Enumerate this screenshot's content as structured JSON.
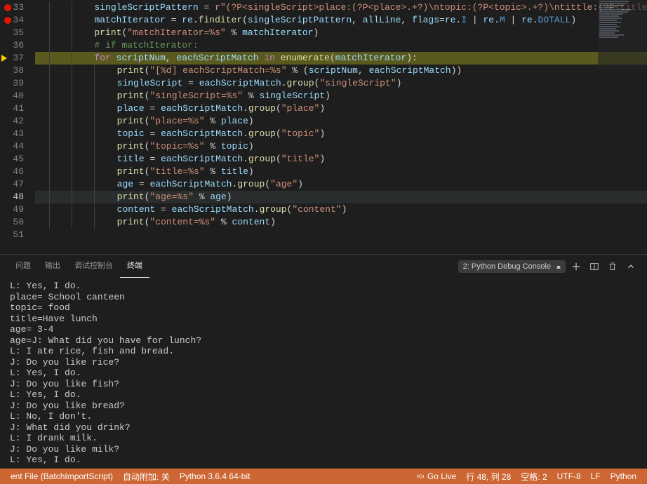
{
  "gutter": {
    "start": 33,
    "end": 51,
    "breakpoints": [
      33,
      34
    ],
    "current_arrow": 37,
    "active_line": 48
  },
  "code": {
    "33": {
      "indent": 2,
      "tokens": [
        [
          "var",
          "singleScriptPattern"
        ],
        [
          "op",
          " = "
        ],
        [
          "kw",
          "r"
        ],
        [
          "str",
          "\"(?P<singleScript>place:(?P<place>.+?)\\ntopic:(?P<topic>.+?)\\ntittle:(?P<title>.+?)"
        ]
      ]
    },
    "34": {
      "indent": 2,
      "tokens": [
        [
          "var",
          "matchIterator"
        ],
        [
          "op",
          " = "
        ],
        [
          "var",
          "re"
        ],
        [
          "op",
          "."
        ],
        [
          "fn",
          "finditer"
        ],
        [
          "op",
          "("
        ],
        [
          "var",
          "singleScriptPattern"
        ],
        [
          "op",
          ", "
        ],
        [
          "var",
          "allLine"
        ],
        [
          "op",
          ", "
        ],
        [
          "var",
          "flags"
        ],
        [
          "op",
          "="
        ],
        [
          "var",
          "re"
        ],
        [
          "op",
          "."
        ],
        [
          "const",
          "I"
        ],
        [
          "op",
          " | "
        ],
        [
          "var",
          "re"
        ],
        [
          "op",
          "."
        ],
        [
          "const",
          "M"
        ],
        [
          "op",
          " | "
        ],
        [
          "var",
          "re"
        ],
        [
          "op",
          "."
        ],
        [
          "const",
          "DOTALL"
        ],
        [
          "op",
          ")"
        ]
      ]
    },
    "35": {
      "indent": 2,
      "tokens": [
        [
          "fn",
          "print"
        ],
        [
          "op",
          "("
        ],
        [
          "str",
          "\"matchIterator=%s\""
        ],
        [
          "op",
          " % "
        ],
        [
          "var",
          "matchIterator"
        ],
        [
          "op",
          ")"
        ]
      ]
    },
    "36": {
      "indent": 2,
      "tokens": [
        [
          "cmt",
          "# if matchIterator:"
        ]
      ]
    },
    "37": {
      "indent": 2,
      "hl": "step",
      "tokens": [
        [
          "kw",
          "for"
        ],
        [
          "op",
          " "
        ],
        [
          "var",
          "scriptNum"
        ],
        [
          "op",
          ", "
        ],
        [
          "var",
          "eachScriptMatch"
        ],
        [
          "op",
          " "
        ],
        [
          "kw",
          "in"
        ],
        [
          "op",
          " "
        ],
        [
          "fn",
          "enumerate"
        ],
        [
          "op",
          "("
        ],
        [
          "var",
          "matchIterator"
        ],
        [
          "op",
          "):"
        ]
      ]
    },
    "38": {
      "indent": 3,
      "tokens": [
        [
          "fn",
          "print"
        ],
        [
          "op",
          "("
        ],
        [
          "str",
          "\"[%d] eachScriptMatch=%s\""
        ],
        [
          "op",
          " % ("
        ],
        [
          "var",
          "scriptNum"
        ],
        [
          "op",
          ", "
        ],
        [
          "var",
          "eachScriptMatch"
        ],
        [
          "op",
          "))"
        ]
      ]
    },
    "39": {
      "indent": 3,
      "tokens": [
        [
          "var",
          "singleScript"
        ],
        [
          "op",
          " = "
        ],
        [
          "var",
          "eachScriptMatch"
        ],
        [
          "op",
          "."
        ],
        [
          "fn",
          "group"
        ],
        [
          "op",
          "("
        ],
        [
          "str",
          "\"singleScript\""
        ],
        [
          "op",
          ")"
        ]
      ]
    },
    "40": {
      "indent": 3,
      "tokens": [
        [
          "fn",
          "print"
        ],
        [
          "op",
          "("
        ],
        [
          "str",
          "\"singleScript=%s\""
        ],
        [
          "op",
          " % "
        ],
        [
          "var",
          "singleScript"
        ],
        [
          "op",
          ")"
        ]
      ]
    },
    "41": {
      "indent": 3,
      "tokens": [
        [
          "var",
          "place"
        ],
        [
          "op",
          " = "
        ],
        [
          "var",
          "eachScriptMatch"
        ],
        [
          "op",
          "."
        ],
        [
          "fn",
          "group"
        ],
        [
          "op",
          "("
        ],
        [
          "str",
          "\"place\""
        ],
        [
          "op",
          ")"
        ]
      ]
    },
    "42": {
      "indent": 3,
      "tokens": [
        [
          "fn",
          "print"
        ],
        [
          "op",
          "("
        ],
        [
          "str",
          "\"place=%s\""
        ],
        [
          "op",
          " % "
        ],
        [
          "var",
          "place"
        ],
        [
          "op",
          ")"
        ]
      ]
    },
    "43": {
      "indent": 3,
      "tokens": [
        [
          "var",
          "topic"
        ],
        [
          "op",
          " = "
        ],
        [
          "var",
          "eachScriptMatch"
        ],
        [
          "op",
          "."
        ],
        [
          "fn",
          "group"
        ],
        [
          "op",
          "("
        ],
        [
          "str",
          "\"topic\""
        ],
        [
          "op",
          ")"
        ]
      ]
    },
    "44": {
      "indent": 3,
      "tokens": [
        [
          "fn",
          "print"
        ],
        [
          "op",
          "("
        ],
        [
          "str",
          "\"topic=%s\""
        ],
        [
          "op",
          " % "
        ],
        [
          "var",
          "topic"
        ],
        [
          "op",
          ")"
        ]
      ]
    },
    "45": {
      "indent": 3,
      "tokens": [
        [
          "var",
          "title"
        ],
        [
          "op",
          " = "
        ],
        [
          "var",
          "eachScriptMatch"
        ],
        [
          "op",
          "."
        ],
        [
          "fn",
          "group"
        ],
        [
          "op",
          "("
        ],
        [
          "str",
          "\"title\""
        ],
        [
          "op",
          ")"
        ]
      ]
    },
    "46": {
      "indent": 3,
      "tokens": [
        [
          "fn",
          "print"
        ],
        [
          "op",
          "("
        ],
        [
          "str",
          "\"title=%s\""
        ],
        [
          "op",
          " % "
        ],
        [
          "var",
          "title"
        ],
        [
          "op",
          ")"
        ]
      ]
    },
    "47": {
      "indent": 3,
      "tokens": [
        [
          "var",
          "age"
        ],
        [
          "op",
          " = "
        ],
        [
          "var",
          "eachScriptMatch"
        ],
        [
          "op",
          "."
        ],
        [
          "fn",
          "group"
        ],
        [
          "op",
          "("
        ],
        [
          "str",
          "\"age\""
        ],
        [
          "op",
          ")"
        ]
      ]
    },
    "48": {
      "indent": 3,
      "hl": "cur",
      "tokens": [
        [
          "fn",
          "print"
        ],
        [
          "op",
          "("
        ],
        [
          "str",
          "\"age=%s\""
        ],
        [
          "op",
          " % "
        ],
        [
          "var",
          "age"
        ],
        [
          "op",
          ")"
        ]
      ]
    },
    "49": {
      "indent": 3,
      "tokens": [
        [
          "var",
          "content"
        ],
        [
          "op",
          " = "
        ],
        [
          "var",
          "eachScriptMatch"
        ],
        [
          "op",
          "."
        ],
        [
          "fn",
          "group"
        ],
        [
          "op",
          "("
        ],
        [
          "str",
          "\"content\""
        ],
        [
          "op",
          ")"
        ]
      ]
    },
    "50": {
      "indent": 3,
      "tokens": [
        [
          "fn",
          "print"
        ],
        [
          "op",
          "("
        ],
        [
          "str",
          "\"content=%s\""
        ],
        [
          "op",
          " % "
        ],
        [
          "var",
          "content"
        ],
        [
          "op",
          ")"
        ]
      ]
    },
    "51": {
      "indent": 0,
      "tokens": []
    }
  },
  "panel": {
    "tabs": [
      "问题",
      "输出",
      "调试控制台",
      "终端"
    ],
    "active_tab": 3,
    "selector": "2: Python Debug Console",
    "icons": [
      "plus",
      "split",
      "trash",
      "chevron-up"
    ]
  },
  "terminal_lines": [
    "L: Yes, I do.",
    "place= School canteen",
    "topic= food",
    "title=Have lunch",
    "age= 3-4",
    "age=J: What did you have for lunch?",
    "L: I ate rice, fish and bread.",
    "J: Do you like rice?",
    "L: Yes, I do.",
    "J: Do you like fish?",
    "L: Yes, I do.",
    "J: Do you like bread?",
    "L: No, I don't.",
    "J: What did you drink?",
    "L: I drank milk.",
    "J: Do you like milk?",
    "L: Yes, I do."
  ],
  "statusbar": {
    "left": [
      "ent File (BatchImportScript)",
      "自动附加: 关",
      "Python 3.6.4 64-bit"
    ],
    "right": [
      "Go Live",
      "行 48, 列 28",
      "空格: 2",
      "UTF-8",
      "LF",
      "Python"
    ]
  },
  "colors": {
    "statusbar_bg": "#cc6633"
  }
}
